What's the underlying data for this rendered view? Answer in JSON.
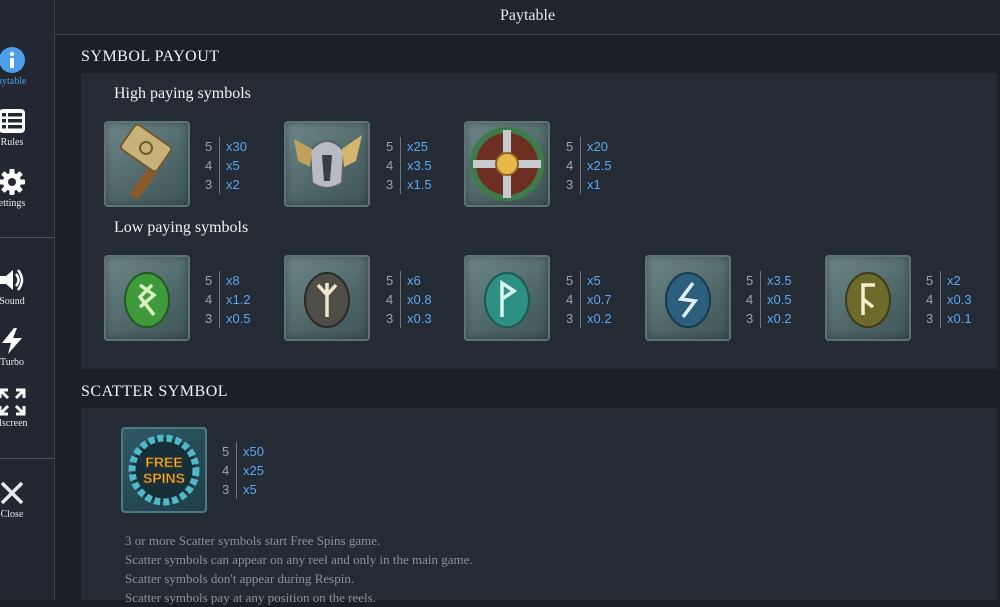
{
  "header": {
    "title": "Paytable"
  },
  "sidebar": {
    "items": [
      {
        "label": "aytable",
        "icon": "info-icon",
        "active": true
      },
      {
        "label": "Rules",
        "icon": "list-icon"
      },
      {
        "label": "ettings",
        "icon": "gear-icon"
      },
      {
        "label": "Sound",
        "icon": "speaker-icon"
      },
      {
        "label": "Turbo",
        "icon": "lightning-icon"
      },
      {
        "label": "llscreen",
        "icon": "fullscreen-icon"
      },
      {
        "label": "Close",
        "icon": "close-icon"
      }
    ]
  },
  "symbol_payout": {
    "title": "SYMBOL PAYOUT",
    "high_title": "High paying symbols",
    "high": [
      {
        "icon": "hammer-icon",
        "pays": [
          {
            "n": "5",
            "x": "x30"
          },
          {
            "n": "4",
            "x": "x5"
          },
          {
            "n": "3",
            "x": "x2"
          }
        ]
      },
      {
        "icon": "helmet-icon",
        "pays": [
          {
            "n": "5",
            "x": "x25"
          },
          {
            "n": "4",
            "x": "x3.5"
          },
          {
            "n": "3",
            "x": "x1.5"
          }
        ]
      },
      {
        "icon": "shield-icon",
        "pays": [
          {
            "n": "5",
            "x": "x20"
          },
          {
            "n": "4",
            "x": "x2.5"
          },
          {
            "n": "3",
            "x": "x1"
          }
        ]
      }
    ],
    "low_title": "Low paying symbols",
    "low": [
      {
        "icon": "green-rune-icon",
        "pays": [
          {
            "n": "5",
            "x": "x8"
          },
          {
            "n": "4",
            "x": "x1.2"
          },
          {
            "n": "3",
            "x": "x0.5"
          }
        ]
      },
      {
        "icon": "grey-rune-icon",
        "pays": [
          {
            "n": "5",
            "x": "x6"
          },
          {
            "n": "4",
            "x": "x0.8"
          },
          {
            "n": "3",
            "x": "x0.3"
          }
        ]
      },
      {
        "icon": "teal-rune-icon",
        "pays": [
          {
            "n": "5",
            "x": "x5"
          },
          {
            "n": "4",
            "x": "x0.7"
          },
          {
            "n": "3",
            "x": "x0.2"
          }
        ]
      },
      {
        "icon": "blue-rune-icon",
        "pays": [
          {
            "n": "5",
            "x": "x3.5"
          },
          {
            "n": "4",
            "x": "x0.5"
          },
          {
            "n": "3",
            "x": "x0.2"
          }
        ]
      },
      {
        "icon": "olive-rune-icon",
        "pays": [
          {
            "n": "5",
            "x": "x2"
          },
          {
            "n": "4",
            "x": "x0.3"
          },
          {
            "n": "3",
            "x": "x0.1"
          }
        ]
      }
    ]
  },
  "scatter": {
    "title": "SCATTER SYMBOL",
    "symbol_text_1": "FREE",
    "symbol_text_2": "SPINS",
    "pays": [
      {
        "n": "5",
        "x": "x50"
      },
      {
        "n": "4",
        "x": "x25"
      },
      {
        "n": "3",
        "x": "x5"
      }
    ],
    "lines": [
      "3 or more Scatter symbols start Free Spins game.",
      "Scatter symbols can appear on any reel and only in the main game.",
      "Scatter symbols don't appear during Respin.",
      "Scatter symbols pay at any position on the reels."
    ]
  },
  "colors": {
    "accent": "#5aa8f0",
    "active_sidebar": "#4a9fe8",
    "panel": "#252b35",
    "background": "#1a1f28"
  }
}
